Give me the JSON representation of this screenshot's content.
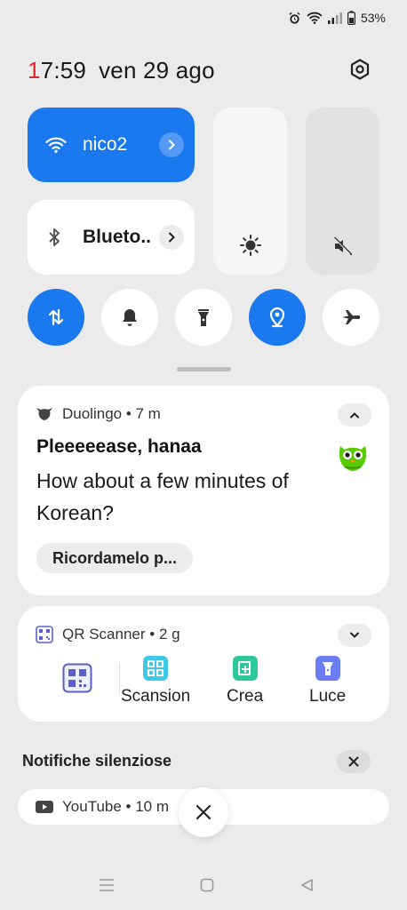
{
  "status": {
    "battery_text": "53%",
    "icons": [
      "alarm-icon",
      "wifi-icon",
      "signal-icon",
      "battery-icon"
    ]
  },
  "header": {
    "time_hour_first_digit": "1",
    "time_rest": "7:59",
    "date": "ven 29 ago"
  },
  "quick_settings": {
    "wifi_label": "nico2",
    "bluetooth_label": "Blueto..",
    "accent_color": "#1b79f0",
    "toggles": [
      {
        "name": "data-transfer",
        "state": "on"
      },
      {
        "name": "bell",
        "state": "off"
      },
      {
        "name": "flashlight",
        "state": "off"
      },
      {
        "name": "location",
        "state": "on"
      },
      {
        "name": "airplane",
        "state": "off"
      }
    ]
  },
  "notifications": {
    "duolingo": {
      "app": "Duolingo • 7 m",
      "title": "Pleeeeease, hanaa",
      "body": "How about a few minutes of Korean?",
      "action": "Ricordamelo p..."
    },
    "qr": {
      "app": "QR Scanner • 2 g",
      "actions": [
        "Scansion",
        "Crea",
        "Luce"
      ]
    },
    "silent_header": "Notifiche silenziose",
    "youtube": {
      "app": "YouTube • 10 m"
    }
  }
}
